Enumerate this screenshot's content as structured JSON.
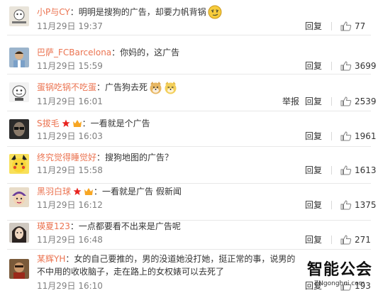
{
  "comments": [
    {
      "user": "小P与CY",
      "text": "明明是搜狗的广告，却要力帆背锅",
      "time": "11月29日 19:37",
      "reply": "回复",
      "likes": "77",
      "report": ""
    },
    {
      "user": "巴萨_FCBarcelona",
      "text": "你妈的，这广告",
      "time": "11月29日 15:59",
      "reply": "回复",
      "likes": "3699",
      "report": ""
    },
    {
      "user": "蛋锅吃锅不吃蛋",
      "text": "广告狗去死",
      "time": "11月29日 16:01",
      "reply": "回复",
      "likes": "2539",
      "report": "举报"
    },
    {
      "user": "S拔毛",
      "text": "一看就是个广告",
      "time": "11月29日 16:03",
      "reply": "回复",
      "likes": "1961",
      "report": ""
    },
    {
      "user": "终究觉得睡觉好",
      "text": "搜狗地图的广告？",
      "time": "11月29日 15:58",
      "reply": "回复",
      "likes": "1613",
      "report": ""
    },
    {
      "user": "黑羽白球",
      "text": "一看就是广告  假新闻",
      "time": "11月29日 16:12",
      "reply": "回复",
      "likes": "1375",
      "report": ""
    },
    {
      "user": "瑛夏123",
      "text": "一点都要看不出来是广告呢",
      "time": "11月29日 16:48",
      "reply": "回复",
      "likes": "271",
      "report": ""
    },
    {
      "user": "某辉YH",
      "text": "女的自己要推的，男的没道她没打她，挺正常的事，说男的不中用的收收脑子，走在路上的女权婊可以去死了",
      "time": "11月29日 16:10",
      "reply": "回复",
      "likes": "193",
      "report": ""
    }
  ],
  "colon": "：",
  "watermark": {
    "brand": "智能公会",
    "url": "ZNgonghui.com"
  },
  "colors": {
    "username": "#eb7350",
    "meta": "#808080",
    "text": "#333333",
    "badge_star": "#e8231f",
    "badge_vip": "#f7a623"
  },
  "icons": {
    "like": "thumbs-up-icon",
    "vip": "vip-crown-icon",
    "star": "star-icon"
  }
}
